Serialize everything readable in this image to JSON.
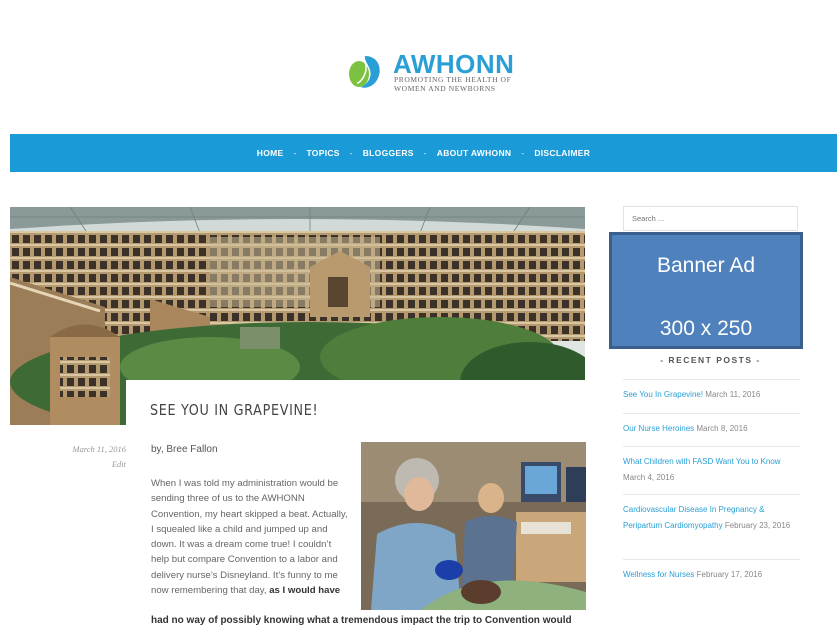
{
  "header": {
    "site_name": "AWHONN",
    "tagline": "PROMOTING THE HEALTH OF\nWOMEN AND NEWBORNS"
  },
  "nav": {
    "items": [
      "HOME",
      "TOPICS",
      "BLOGGERS",
      "ABOUT AWHONN",
      "DISCLAIMER"
    ],
    "separator": "-"
  },
  "post": {
    "title": "SEE YOU IN GRAPEVINE!",
    "date": "March 11, 2016",
    "edit_label": "Edit",
    "byline": "by, Bree Fallon",
    "body_plain": "When I was told my administration would be sending three of us to the AWHONN Convention, my heart skipped a beat. Actually, I squealed like a child and jumped up and down. It was a dream come true! I couldn’t help but compare Convention to a labor and delivery nurse’s Disneyland. It’s funny to me now remembering that day, ",
    "body_bold": "as I would have",
    "last_line": "had no way of possibly knowing what a tremendous impact the trip to Convention would"
  },
  "sidebar": {
    "search_placeholder": "Search ...",
    "banner_line1": "Banner Ad",
    "banner_line2": "300 x 250",
    "recent_heading": "- RECENT POSTS -",
    "recent_posts": [
      {
        "title": "See You In Grapevine!",
        "date": "March 11, 2016"
      },
      {
        "title": "Our Nurse Heroines",
        "date": "March 8, 2016"
      },
      {
        "title": "What Children with FASD Want You to Know",
        "date": "March 4, 2016"
      },
      {
        "title": "Cardiovascular Disease In Pregnancy & Peripartum Cardiomyopathy",
        "date": "February 23, 2016"
      },
      {
        "title": "Wellness for Nurses",
        "date": "February 17, 2016"
      }
    ]
  },
  "colors": {
    "nav_bg": "#1a9ad6",
    "brand_blue": "#2a9fd6",
    "logo_green": "#7cc242",
    "banner_fill": "#4f81bd"
  }
}
